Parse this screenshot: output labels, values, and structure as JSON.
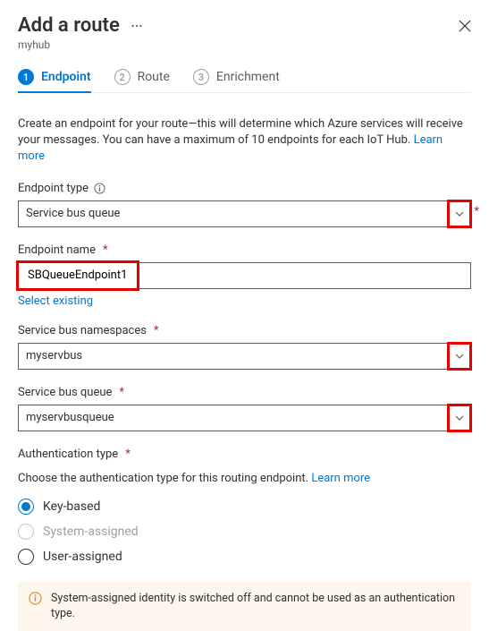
{
  "header": {
    "title": "Add a route",
    "resource": "myhub"
  },
  "tabs": [
    {
      "num": "1",
      "label": "Endpoint",
      "active": true
    },
    {
      "num": "2",
      "label": "Route",
      "active": false
    },
    {
      "num": "3",
      "label": "Enrichment",
      "active": false
    }
  ],
  "description": {
    "text": "Create an endpoint for your route—this will determine which Azure services will receive your messages. You can have a maximum of 10 endpoints for each IoT Hub.",
    "learn_more": "Learn more"
  },
  "fields": {
    "endpoint_type": {
      "label": "Endpoint type",
      "value": "Service bus queue"
    },
    "endpoint_name": {
      "label": "Endpoint name",
      "value": "SBQueueEndpoint1",
      "select_existing": "Select existing"
    },
    "sb_namespaces": {
      "label": "Service bus namespaces",
      "value": "myservbus"
    },
    "sb_queue": {
      "label": "Service bus queue",
      "value": "myservbusqueue"
    },
    "auth_type": {
      "label": "Authentication type",
      "help": "Choose the authentication type for this routing endpoint.",
      "learn_more": "Learn more",
      "options": {
        "key_based": "Key-based",
        "system_assigned": "System-assigned",
        "user_assigned": "User-assigned"
      }
    }
  },
  "banner": {
    "message": "System-assigned identity is switched off and cannot be used as an authentication type."
  }
}
